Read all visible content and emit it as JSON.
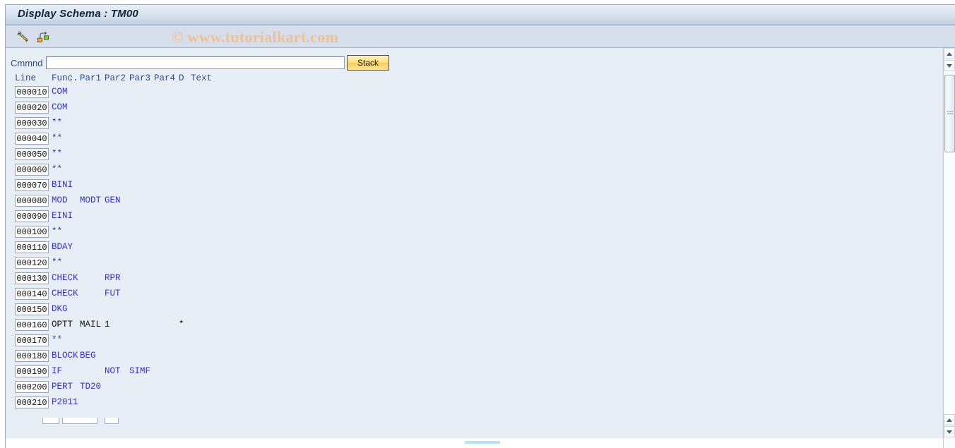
{
  "window": {
    "title": "Display Schema : TM00"
  },
  "watermark": {
    "text": "© www.tutorialkart.com"
  },
  "toolbar": {
    "items": [
      {
        "name": "edit-pencil-icon",
        "tooltip": "Change"
      },
      {
        "name": "structure-icon",
        "tooltip": "Structure / Hierarchy"
      }
    ]
  },
  "command": {
    "label": "Cmmnd",
    "value": "",
    "placeholder": "",
    "stack_label": "Stack"
  },
  "grid": {
    "headers": {
      "line": "Line",
      "func": "Func.",
      "par1": "Par1",
      "par2": "Par2",
      "par3": "Par3",
      "par4": "Par4",
      "d": "D",
      "text": "Text"
    },
    "rows": [
      {
        "line": "000010",
        "func": "COM",
        "par1": "",
        "par2": "",
        "par3": "",
        "par4": "",
        "d": "",
        "text": "",
        "color": "blue"
      },
      {
        "line": "000020",
        "func": "COM",
        "par1": "",
        "par2": "",
        "par3": "",
        "par4": "",
        "d": "",
        "text": "",
        "color": "blue"
      },
      {
        "line": "000030",
        "func": "**",
        "par1": "",
        "par2": "",
        "par3": "",
        "par4": "",
        "d": "",
        "text": "",
        "color": "blue"
      },
      {
        "line": "000040",
        "func": "**",
        "par1": "",
        "par2": "",
        "par3": "",
        "par4": "",
        "d": "",
        "text": "",
        "color": "blue"
      },
      {
        "line": "000050",
        "func": "**",
        "par1": "",
        "par2": "",
        "par3": "",
        "par4": "",
        "d": "",
        "text": "",
        "color": "blue"
      },
      {
        "line": "000060",
        "func": "**",
        "par1": "",
        "par2": "",
        "par3": "",
        "par4": "",
        "d": "",
        "text": "",
        "color": "blue"
      },
      {
        "line": "000070",
        "func": "BINI",
        "par1": "",
        "par2": "",
        "par3": "",
        "par4": "",
        "d": "",
        "text": "",
        "color": "blue"
      },
      {
        "line": "000080",
        "func": "MOD",
        "par1": "MODT",
        "par2": "GEN",
        "par3": "",
        "par4": "",
        "d": "",
        "text": "",
        "color": "blue"
      },
      {
        "line": "000090",
        "func": "EINI",
        "par1": "",
        "par2": "",
        "par3": "",
        "par4": "",
        "d": "",
        "text": "",
        "color": "blue"
      },
      {
        "line": "000100",
        "func": "**",
        "par1": "",
        "par2": "",
        "par3": "",
        "par4": "",
        "d": "",
        "text": "",
        "color": "blue"
      },
      {
        "line": "000110",
        "func": "BDAY",
        "par1": "",
        "par2": "",
        "par3": "",
        "par4": "",
        "d": "",
        "text": "",
        "color": "blue"
      },
      {
        "line": "000120",
        "func": "**",
        "par1": "",
        "par2": "",
        "par3": "",
        "par4": "",
        "d": "",
        "text": "",
        "color": "blue"
      },
      {
        "line": "000130",
        "func": "CHECK",
        "par1": "",
        "par2": "RPR",
        "par3": "",
        "par4": "",
        "d": "",
        "text": "",
        "color": "blue"
      },
      {
        "line": "000140",
        "func": "CHECK",
        "par1": "",
        "par2": "FUT",
        "par3": "",
        "par4": "",
        "d": "",
        "text": "",
        "color": "blue"
      },
      {
        "line": "000150",
        "func": "DKG",
        "par1": "",
        "par2": "",
        "par3": "",
        "par4": "",
        "d": "",
        "text": "",
        "color": "blue"
      },
      {
        "line": "000160",
        "func": "OPTT",
        "par1": "MAIL",
        "par2": "1",
        "par3": "",
        "par4": "",
        "d": "*",
        "text": "",
        "color": "black"
      },
      {
        "line": "000170",
        "func": "**",
        "par1": "",
        "par2": "",
        "par3": "",
        "par4": "",
        "d": "",
        "text": "",
        "color": "blue"
      },
      {
        "line": "000180",
        "func": "BLOCK",
        "par1": "BEG",
        "par2": "",
        "par3": "",
        "par4": "",
        "d": "",
        "text": "",
        "color": "blue"
      },
      {
        "line": "000190",
        "func": "IF",
        "par1": "",
        "par2": "NOT",
        "par3": "SIMF",
        "par4": "",
        "d": "",
        "text": "",
        "color": "blue"
      },
      {
        "line": "000200",
        "func": "PERT",
        "par1": "TD20",
        "par2": "",
        "par3": "",
        "par4": "",
        "d": "",
        "text": "",
        "color": "blue"
      },
      {
        "line": "000210",
        "func": "P2011",
        "par1": "",
        "par2": "",
        "par3": "",
        "par4": "",
        "d": "",
        "text": "",
        "color": "blue"
      }
    ]
  },
  "colors": {
    "title_bar_start": "#eaf0f7",
    "title_bar_end": "#b4c6dc",
    "toolbar_bg": "#d4dfeb",
    "content_bg": "#e8eef6",
    "label_blue": "#2a4b8d",
    "data_blue": "#3333cc",
    "data_black": "#111111",
    "stack_button": "#ffe07e",
    "watermark": "#eec194",
    "hscroll_thumb": "#b9e3f5"
  }
}
